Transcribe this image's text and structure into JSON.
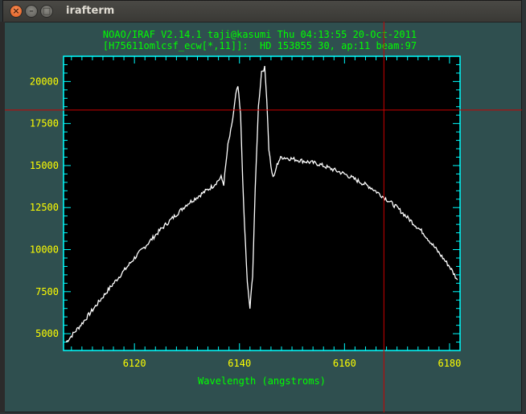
{
  "window": {
    "title": "irafterm"
  },
  "terminal": {
    "header_line1": "NOAO/IRAF V2.14.1 taji@kasumi Thu 04:13:55 20-Oct-2011",
    "header_line2": "[H75611omlcsf_ecw[*,11]]:  HD 153855 30, ap:11 beam:97"
  },
  "chart_data": {
    "type": "line",
    "xlabel": "Wavelength (angstroms)",
    "ylabel": "",
    "xlim": [
      6106.5,
      6182
    ],
    "ylim": [
      4000,
      21500
    ],
    "x_ticks": [
      6120,
      6140,
      6160,
      6180
    ],
    "y_ticks": [
      5000,
      7500,
      10000,
      12500,
      15000,
      17500,
      20000
    ],
    "x_tick_labels": [
      "6120",
      "6140",
      "6160",
      "6180"
    ],
    "y_tick_labels": [
      "5000",
      "7500",
      "10000",
      "12500",
      "15000",
      "17500",
      "20000"
    ],
    "crosshair": {
      "x": 6167.5,
      "y": 18300
    },
    "colors": {
      "plot_bg": "#000000",
      "axes": "#00ffff",
      "tick_labels": "#ffff00",
      "xlabel": "#00ff00",
      "curve": "#ffffff",
      "crosshair": "#cc0000"
    },
    "series": [
      {
        "x": [
          6107,
          6110,
          6115,
          6120,
          6125,
          6130,
          6135,
          6136.5,
          6137,
          6137.8,
          6138.5,
          6139.3,
          6139.7,
          6140.2,
          6140.8,
          6141.5,
          6142,
          6142.5,
          6143,
          6143.6,
          6144.2,
          6144.8,
          6145.2,
          6145.6,
          6146.2,
          6146.6,
          6147,
          6147.5,
          6148,
          6150,
          6155,
          6160,
          6165,
          6168,
          6170,
          6175,
          6180,
          6181.5
        ],
        "y": [
          4500,
          5600,
          7600,
          9500,
          11200,
          12700,
          13800,
          14300,
          13900,
          16200,
          17300,
          19200,
          19700,
          18000,
          12500,
          8000,
          6500,
          8500,
          13500,
          18500,
          20600,
          20800,
          19000,
          16000,
          14500,
          14300,
          14900,
          15300,
          15500,
          15400,
          15100,
          14500,
          13700,
          13000,
          12500,
          11000,
          9000,
          8200
        ]
      }
    ]
  }
}
